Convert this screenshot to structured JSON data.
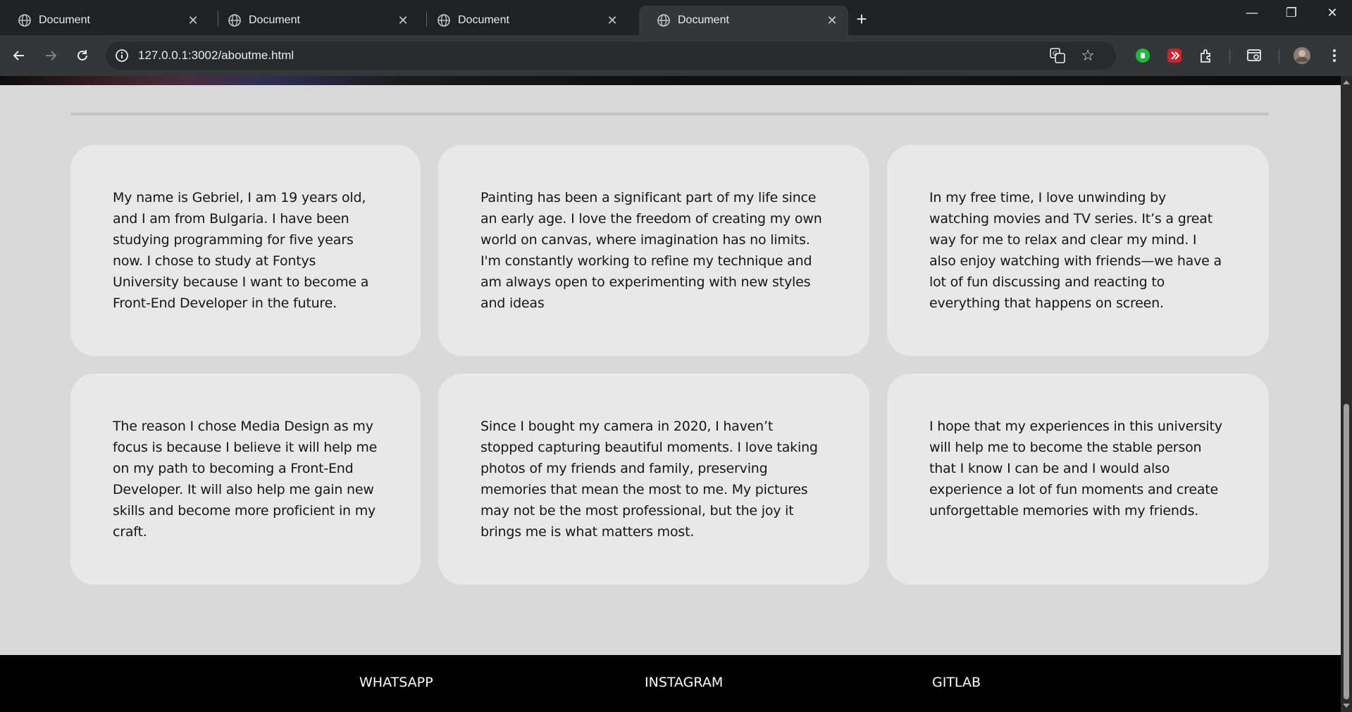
{
  "browser": {
    "tabs": [
      {
        "title": "Document",
        "active": false
      },
      {
        "title": "Document",
        "active": false
      },
      {
        "title": "Document",
        "active": false
      },
      {
        "title": "Document",
        "active": true
      }
    ],
    "url": "127.0.0.1:3002/aboutme.html"
  },
  "cards": [
    {
      "text": "My name is Gebriel, I am 19 years old, and I am from Bulgaria. I have been studying programming for five years now. I chose to study at Fontys University because I want to become a Front-End Developer in the future."
    },
    {
      "text": "Painting has been a significant part of my life since an early age. I love the freedom of creating my own world on canvas, where imagination has no limits. I'm constantly working to refine my technique and am always open to experimenting with new styles and ideas"
    },
    {
      "text": "In my free time, I love unwinding by watching movies and TV series. It’s a great way for me to relax and clear my mind. I also enjoy watching with friends—we have a lot of fun discussing and reacting to everything that happens on screen."
    },
    {
      "text": "The reason I chose Media Design as my focus is because I believe it will help me on my path to becoming a Front-End Developer. It will also help me gain new skills and become more proficient in my craft."
    },
    {
      "text": "Since I bought my camera in 2020, I haven’t stopped capturing beautiful moments. I love taking photos of my friends and family, preserving memories that mean the most to me. My pictures may not be the most professional, but the joy it brings me is what matters most."
    },
    {
      "text": "I hope that my experiences in this university will help me to become the stable person that I know I can be and I would also experience a lot of fun moments and create unforgettable memories with my friends."
    }
  ],
  "footer": {
    "links": [
      "WHATSAPP",
      "INSTAGRAM",
      "GITLAB"
    ]
  },
  "colors": {
    "page_bg": "#d9d9d9",
    "card_bg": "#e8e8e8",
    "footer_bg": "#000000",
    "browser_chrome": "#202124"
  }
}
